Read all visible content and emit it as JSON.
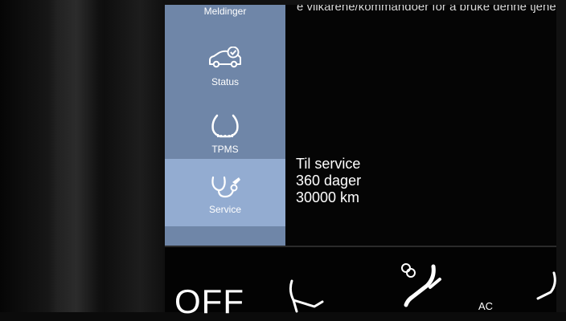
{
  "sidebar": {
    "items": [
      {
        "label": "Meldinger",
        "icon": "message-icon"
      },
      {
        "label": "Status",
        "icon": "car-check-icon"
      },
      {
        "label": "TPMS",
        "icon": "tire-pressure-icon"
      },
      {
        "label": "Service",
        "icon": "service-wrench-icon",
        "active": true
      }
    ]
  },
  "main": {
    "top_text": "e vilkårene/kommandoer for å bruke denne tjene",
    "service_lines": [
      "Til service",
      "360 dager",
      "30000 km"
    ]
  },
  "climate_bar": {
    "off_label": "OFF",
    "ac_label": "AC"
  },
  "colors": {
    "sidebar_bg": "#6f86a8",
    "sidebar_active": "#93acd1"
  }
}
